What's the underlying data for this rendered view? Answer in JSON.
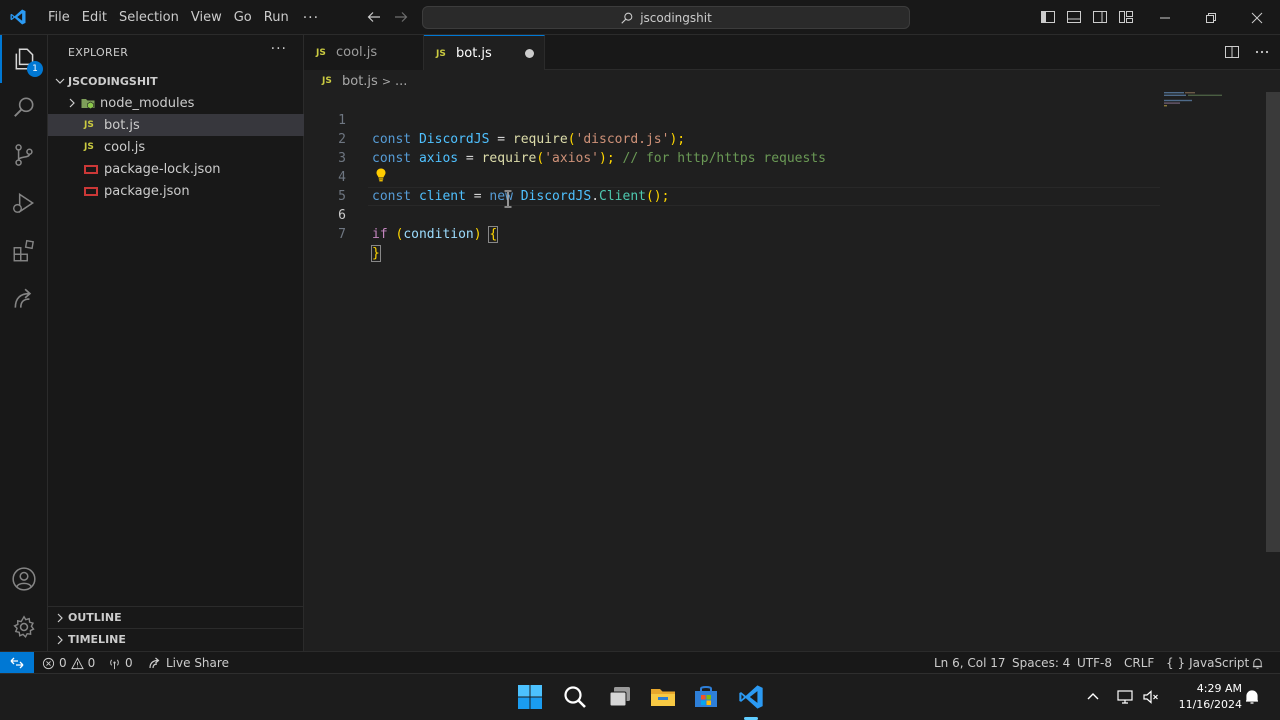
{
  "titlebar": {
    "menu": [
      "File",
      "Edit",
      "Selection",
      "View",
      "Go",
      "Run"
    ],
    "more": "···",
    "search_text": "jscodingshit"
  },
  "activitybar": {
    "items": [
      "explorer-icon",
      "search-icon",
      "source-control-icon",
      "run-debug-icon",
      "extensions-icon",
      "remote-explorer-icon"
    ],
    "explorer_badge": "1",
    "bottom": [
      "account-icon",
      "settings-gear-icon"
    ]
  },
  "sidebar": {
    "title": "EXPLORER",
    "more": "···",
    "folder": "JSCODINGSHIT",
    "items": [
      {
        "label": "node_modules",
        "type": "folder"
      },
      {
        "label": "bot.js",
        "type": "js",
        "selected": true
      },
      {
        "label": "cool.js",
        "type": "js"
      },
      {
        "label": "package-lock.json",
        "type": "json"
      },
      {
        "label": "package.json",
        "type": "json"
      }
    ],
    "js_badge": "JS",
    "outline": "OUTLINE",
    "timeline": "TIMELINE"
  },
  "tabs": [
    {
      "badge": "JS",
      "label": "cool.js",
      "active": false
    },
    {
      "badge": "JS",
      "label": "bot.js",
      "active": true,
      "dirty": true
    }
  ],
  "breadcrumb": {
    "badge": "JS",
    "file": "bot.js",
    "sep": ">",
    "rest": "..."
  },
  "editor": {
    "line_numbers": [
      "1",
      "2",
      "3",
      "4",
      "5",
      "6",
      "7"
    ],
    "current_line": 6,
    "l1": {
      "kw": "const",
      "name": "DiscordJS",
      "eq": " = ",
      "fn": "require",
      "open": "(",
      "str": "'discord.js'",
      "close": ");"
    },
    "l2": {
      "kw": "const",
      "name": "axios",
      "eq": " = ",
      "fn": "require",
      "open": "(",
      "str": "'axios'",
      "close": ");",
      "comment": "// for http/https requests"
    },
    "l4": {
      "kw": "const",
      "name": "client",
      "eq": " = ",
      "new": "new",
      "cls": "DiscordJS",
      "dot": ".",
      "method": "Client",
      "tail": "();"
    },
    "l6": {
      "kw": "if",
      "open": " (",
      "cond": "condition",
      "close": ") ",
      "brace": "{"
    },
    "l7": {
      "brace": "}"
    }
  },
  "statusbar": {
    "errors": "0",
    "warnings": "0",
    "ports": "0",
    "live_share": "Live Share",
    "position": "Ln 6, Col 17",
    "spaces": "Spaces: 4",
    "encoding": "UTF-8",
    "eol": "CRLF",
    "lang_braces": "{ }",
    "language": "JavaScript"
  },
  "taskbar": {
    "time": "4:29 AM",
    "date": "11/16/2024"
  },
  "colors": {
    "accent": "#0078d4",
    "keyword": "#569cd6",
    "string": "#ce9178",
    "comment": "#6a9955",
    "function": "#dcdcaa"
  }
}
